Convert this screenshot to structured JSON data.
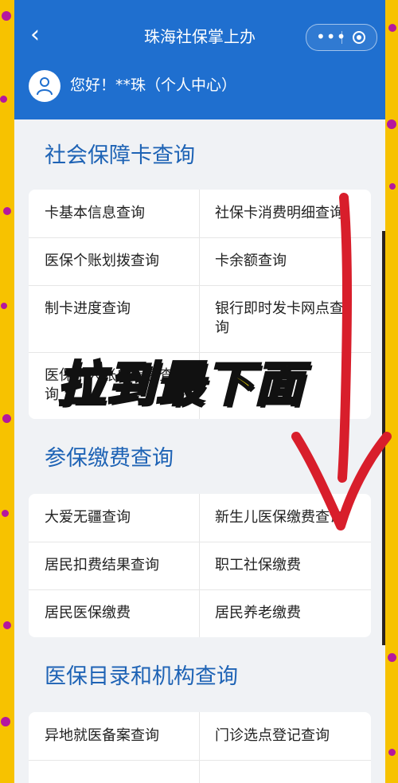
{
  "header": {
    "title": "珠海社保掌上办",
    "back_icon": "chevron-left-icon",
    "more_icon": "more-dots-icon",
    "close_icon": "target-close-icon",
    "color": "#1f6fcf"
  },
  "user": {
    "greeting": "您好！**珠（个人中心）",
    "avatar_icon": "user-avatar-icon"
  },
  "sections": [
    {
      "title": "社会保障卡查询",
      "items": [
        "卡基本信息查询",
        "社保卡消费明细查询",
        "医保个账划拨查询",
        "卡余额查询",
        "制卡进度查询",
        "银行即时发卡网点查询",
        "医保个人账户信息查询",
        ""
      ]
    },
    {
      "title": "参保缴费查询",
      "items": [
        "大爱无疆查询",
        "新生儿医保缴费查询",
        "居民扣费结果查询",
        "职工社保缴费",
        "居民医保缴费",
        "居民养老缴费"
      ]
    },
    {
      "title": "医保目录和机构查询",
      "items": [
        "异地就医备案查询",
        "门诊选点登记查询"
      ]
    }
  ],
  "overlay": {
    "caption": "拉到最下面",
    "caption_color": "#ffe600",
    "arrow_color": "#d81e2b"
  },
  "theme": {
    "background": "#f7c200",
    "dot_color": "#b5179e",
    "section_title_color": "#1e63b5"
  }
}
